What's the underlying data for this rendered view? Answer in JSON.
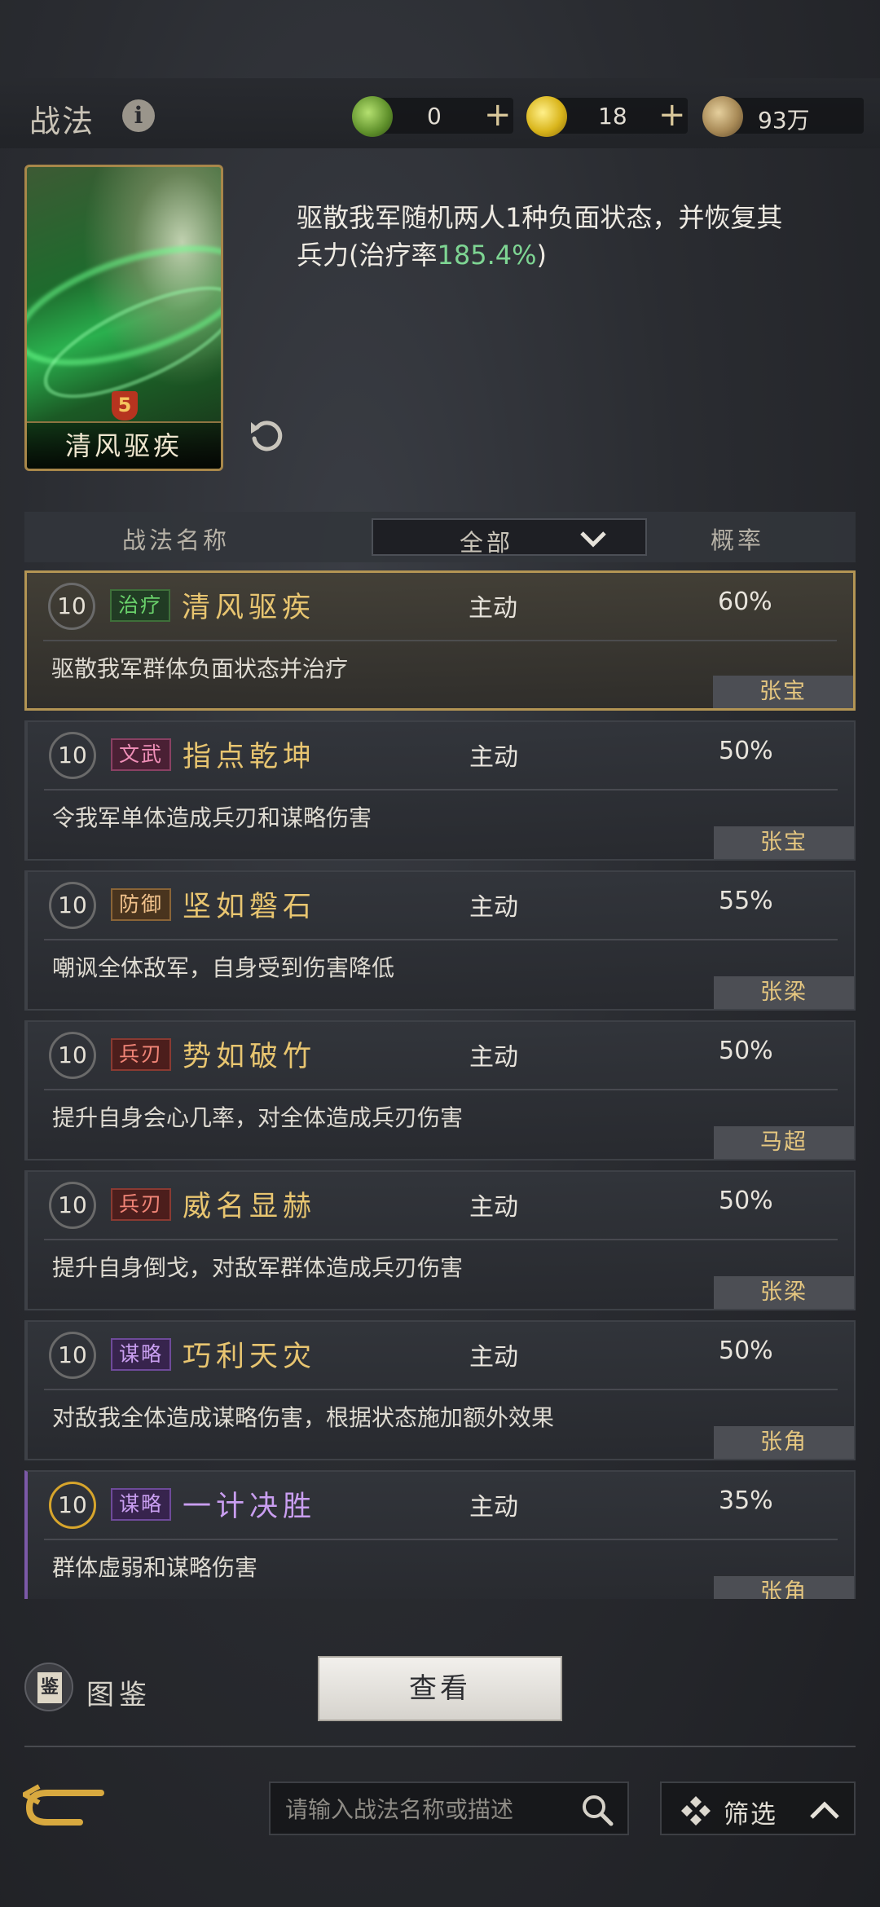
{
  "header": {
    "title": "战法"
  },
  "currencies": [
    {
      "name": "jade-token",
      "value": "0",
      "color": "#6fae3b"
    },
    {
      "name": "gold-coin",
      "value": "18",
      "color": "#d4b21e"
    },
    {
      "name": "copper-coin",
      "value": "93万",
      "color": "#a88a57"
    }
  ],
  "selected": {
    "card_name": "清风驱疾",
    "card_mark": "5",
    "description_prefix": "驱散我军随机两人1种负面状态，并恢复其兵力(治疗率",
    "description_value": "185.4%",
    "description_suffix": ")"
  },
  "table": {
    "col_name": "战法名称",
    "col_filter": "全部",
    "col_rate": "概率"
  },
  "skills": [
    {
      "level": "10",
      "tag": "治疗",
      "tag_type": "heal",
      "name": "清风驱疾",
      "type": "主动",
      "rate": "60%",
      "desc": "驱散我军群体负面状态并治疗",
      "owner": "张宝"
    },
    {
      "level": "10",
      "tag": "文武",
      "tag_type": "wen",
      "name": "指点乾坤",
      "type": "主动",
      "rate": "50%",
      "desc": "令我军单体造成兵刃和谋略伤害",
      "owner": "张宝"
    },
    {
      "level": "10",
      "tag": "防御",
      "tag_type": "def",
      "name": "坚如磐石",
      "type": "主动",
      "rate": "55%",
      "desc": "嘲讽全体敌军，自身受到伤害降低",
      "owner": "张梁"
    },
    {
      "level": "10",
      "tag": "兵刃",
      "tag_type": "bing",
      "name": "势如破竹",
      "type": "主动",
      "rate": "50%",
      "desc": "提升自身会心几率，对全体造成兵刃伤害",
      "owner": "马超"
    },
    {
      "level": "10",
      "tag": "兵刃",
      "tag_type": "bing",
      "name": "威名显赫",
      "type": "主动",
      "rate": "50%",
      "desc": "提升自身倒戈，对敌军群体造成兵刃伤害",
      "owner": "张梁"
    },
    {
      "level": "10",
      "tag": "谋略",
      "tag_type": "mou",
      "name": "巧利天灾",
      "type": "主动",
      "rate": "50%",
      "desc": "对敌我全体造成谋略伤害，根据状态施加额外效果",
      "owner": "张角"
    },
    {
      "level": "10",
      "tag": "谋略",
      "tag_type": "mou",
      "name": "一计决胜",
      "type": "主动",
      "rate": "35%",
      "desc": "群体虚弱和谋略伤害",
      "owner": "张角"
    }
  ],
  "footer": {
    "tujian_icon_char": "鉴",
    "tujian_label": "图鉴",
    "view_button": "查看",
    "search_placeholder": "请输入战法名称或描述",
    "filter_label": "筛选"
  }
}
